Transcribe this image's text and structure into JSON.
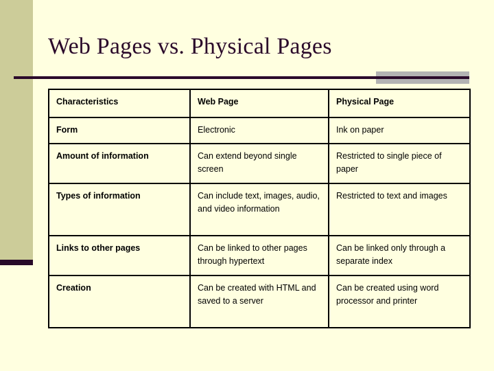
{
  "slide": {
    "title": "Web Pages vs. Physical Pages",
    "background_color": "#FFFFE0",
    "accent_color": "#2B0A2B",
    "sidebar_color": "#CCCC99",
    "band_color": "#B3B3B3"
  },
  "table": {
    "headers": [
      "Characteristics",
      "Web Page",
      "Physical Page"
    ],
    "rows": [
      {
        "characteristic": "Form",
        "web_page": "Electronic",
        "physical_page": "Ink on paper"
      },
      {
        "characteristic": "Amount of information",
        "web_page": "Can extend beyond single screen",
        "physical_page": "Restricted to single piece of paper"
      },
      {
        "characteristic": "Types of information",
        "web_page": "Can include text, images, audio, and video information",
        "physical_page": "Restricted to text and images"
      },
      {
        "characteristic": "Links to other pages",
        "web_page": "Can be linked to other pages through hypertext",
        "physical_page": "Can be linked only through a separate index"
      },
      {
        "characteristic": "Creation",
        "web_page": "Can be created with HTML and saved to a server",
        "physical_page": "Can be created using word processor and printer"
      }
    ]
  }
}
